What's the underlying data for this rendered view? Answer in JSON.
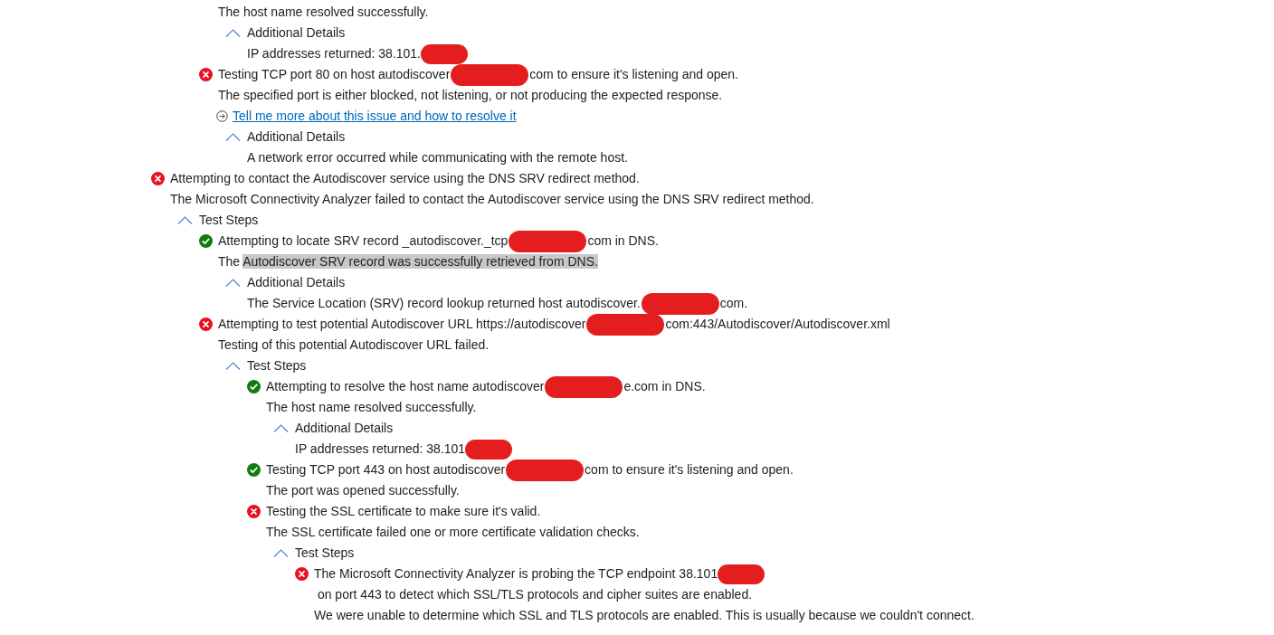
{
  "results": [
    {
      "kind": "continuation",
      "children": [
        {
          "kind": "step",
          "children": [
            {
              "kind": "text",
              "parts": [
                {
                  "kind": "text",
                  "text": "The host name resolved successfully."
                }
              ]
            },
            {
              "kind": "section",
              "label": "Additional Details",
              "expanded": true,
              "children": [
                {
                  "kind": "text",
                  "parts": [
                    {
                      "kind": "text",
                      "text": "IP addresses returned: 38.101."
                    },
                    {
                      "kind": "redaction",
                      "wide": false
                    }
                  ]
                }
              ]
            }
          ]
        },
        {
          "kind": "step",
          "passed": false,
          "parts": [
            {
              "kind": "text",
              "text": "Testing TCP port 80 on host autodiscover"
            },
            {
              "kind": "redaction",
              "wide": true
            },
            {
              "kind": "text",
              "text": "com to ensure it's listening and open."
            }
          ],
          "children": [
            {
              "kind": "text",
              "parts": [
                {
                  "kind": "text",
                  "text": "The specified port is either blocked, not listening, or not producing the expected response."
                }
              ]
            },
            {
              "kind": "link",
              "text": "Tell me more about this issue and how to resolve it"
            },
            {
              "kind": "section",
              "label": "Additional Details",
              "expanded": true,
              "children": [
                {
                  "kind": "text",
                  "parts": [
                    {
                      "kind": "text",
                      "text": "A network error occurred while communicating with the remote host."
                    }
                  ]
                }
              ]
            }
          ]
        }
      ]
    },
    {
      "kind": "step",
      "passed": false,
      "parts": [
        {
          "kind": "text",
          "text": "Attempting to contact the Autodiscover service using the DNS SRV redirect method."
        }
      ],
      "children": [
        {
          "kind": "text",
          "parts": [
            {
              "kind": "text",
              "text": "The Microsoft Connectivity Analyzer failed to contact the Autodiscover service using the DNS SRV redirect method."
            }
          ]
        },
        {
          "kind": "section",
          "label": "Test Steps",
          "expanded": true,
          "children": [
            {
              "kind": "step",
              "passed": true,
              "parts": [
                {
                  "kind": "text",
                  "text": "Attempting to locate SRV record _autodiscover._tcp"
                },
                {
                  "kind": "redaction",
                  "wide": true
                },
                {
                  "kind": "text",
                  "text": "com in DNS."
                }
              ],
              "children": [
                {
                  "kind": "text",
                  "parts": [
                    {
                      "kind": "text",
                      "text": "The "
                    },
                    {
                      "kind": "highlight",
                      "text": "Autodiscover SRV record was successfully retrieved from DNS."
                    }
                  ]
                },
                {
                  "kind": "section",
                  "label": "Additional Details",
                  "expanded": true,
                  "children": [
                    {
                      "kind": "text",
                      "parts": [
                        {
                          "kind": "text",
                          "text": "The Service Location (SRV) record lookup returned host autodiscover."
                        },
                        {
                          "kind": "redaction",
                          "wide": true
                        },
                        {
                          "kind": "text",
                          "text": "com."
                        }
                      ]
                    }
                  ]
                }
              ]
            },
            {
              "kind": "step",
              "passed": false,
              "parts": [
                {
                  "kind": "text",
                  "text": "Attempting to test potential Autodiscover URL https://autodiscover"
                },
                {
                  "kind": "redaction",
                  "wide": true
                },
                {
                  "kind": "text",
                  "text": "com:443/Autodiscover/Autodiscover.xml"
                }
              ],
              "children": [
                {
                  "kind": "text",
                  "parts": [
                    {
                      "kind": "text",
                      "text": "Testing of this potential Autodiscover URL failed."
                    }
                  ]
                },
                {
                  "kind": "section",
                  "label": "Test Steps",
                  "expanded": true,
                  "children": [
                    {
                      "kind": "step",
                      "passed": true,
                      "parts": [
                        {
                          "kind": "text",
                          "text": "Attempting to resolve the host name autodiscover"
                        },
                        {
                          "kind": "redaction",
                          "wide": true
                        },
                        {
                          "kind": "text",
                          "text": "e.com in DNS."
                        }
                      ],
                      "children": [
                        {
                          "kind": "text",
                          "parts": [
                            {
                              "kind": "text",
                              "text": "The host name resolved successfully."
                            }
                          ]
                        },
                        {
                          "kind": "section",
                          "label": "Additional Details",
                          "expanded": true,
                          "children": [
                            {
                              "kind": "text",
                              "parts": [
                                {
                                  "kind": "text",
                                  "text": "IP addresses returned: 38.101"
                                },
                                {
                                  "kind": "redaction",
                                  "wide": false
                                }
                              ]
                            }
                          ]
                        }
                      ]
                    },
                    {
                      "kind": "step",
                      "passed": true,
                      "parts": [
                        {
                          "kind": "text",
                          "text": "Testing TCP port 443 on host autodiscover"
                        },
                        {
                          "kind": "redaction",
                          "wide": true
                        },
                        {
                          "kind": "text",
                          "text": "com to ensure it's listening and open."
                        }
                      ],
                      "children": [
                        {
                          "kind": "text",
                          "parts": [
                            {
                              "kind": "text",
                              "text": "The port was opened successfully."
                            }
                          ]
                        }
                      ]
                    },
                    {
                      "kind": "step",
                      "passed": false,
                      "parts": [
                        {
                          "kind": "text",
                          "text": "Testing the SSL certificate to make sure it's valid."
                        }
                      ],
                      "children": [
                        {
                          "kind": "text",
                          "parts": [
                            {
                              "kind": "text",
                              "text": "The SSL certificate failed one or more certificate validation checks."
                            }
                          ]
                        },
                        {
                          "kind": "section",
                          "label": "Test Steps",
                          "expanded": true,
                          "children": [
                            {
                              "kind": "step",
                              "passed": false,
                              "parts": [
                                {
                                  "kind": "text",
                                  "text": "The Microsoft Connectivity Analyzer is probing the TCP endpoint 38.101"
                                },
                                {
                                  "kind": "redaction",
                                  "wide": false
                                },
                                {
                                  "kind": "text",
                                  "text": " on port 443 to detect which SSL/TLS protocols and "
                                },
                                {
                                  "kind": "text",
                                  "text": "cipher suites are enabled."
                                }
                              ],
                              "children": [
                                {
                                  "kind": "text",
                                  "parts": [
                                    {
                                      "kind": "text",
                                      "text": "We were unable to determine which SSL and TLS protocols are enabled. This is usually because we couldn't connect."
                                    }
                                  ]
                                }
                              ]
                            }
                          ]
                        }
                      ]
                    }
                  ]
                }
              ]
            }
          ]
        }
      ]
    }
  ]
}
